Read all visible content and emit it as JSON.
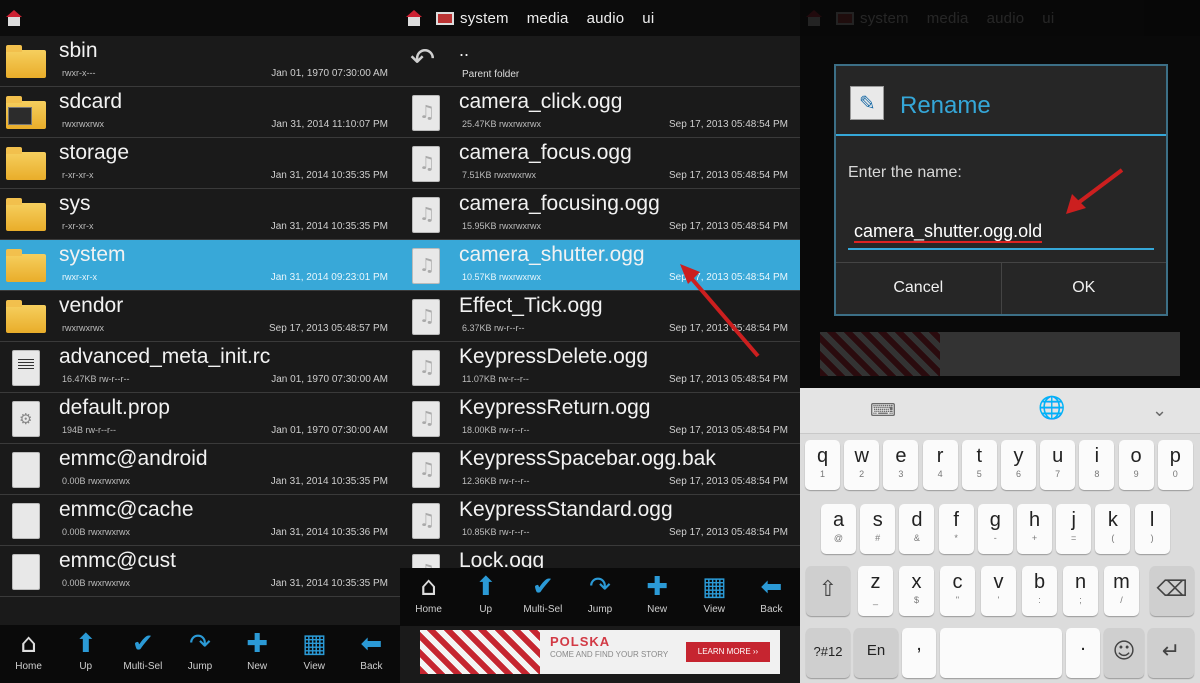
{
  "panel1": {
    "rows": [
      {
        "name": "sbin",
        "meta": "rwxr-x---",
        "date": "Jan 01, 1970 07:30:00 AM",
        "icon": "folder-icon"
      },
      {
        "name": "sdcard",
        "meta": "rwxrwxrwx",
        "date": "Jan 31, 2014 11:10:07 PM",
        "icon": "sdcard-folder-icon"
      },
      {
        "name": "storage",
        "meta": "r-xr-xr-x",
        "date": "Jan 31, 2014 10:35:35 PM",
        "icon": "folder-icon"
      },
      {
        "name": "sys",
        "meta": "r-xr-xr-x",
        "date": "Jan 31, 2014 10:35:35 PM",
        "icon": "folder-icon"
      },
      {
        "name": "system",
        "meta": "rwxr-xr-x",
        "date": "Jan 31, 2014 09:23:01 PM",
        "icon": "folder-icon",
        "selected": true
      },
      {
        "name": "vendor",
        "meta": "rwxrwxrwx",
        "date": "Sep 17, 2013 05:48:57 PM",
        "icon": "folder-icon"
      },
      {
        "name": "advanced_meta_init.rc",
        "meta": "16.47KB rw-r--r--",
        "date": "Jan 01, 1970 07:30:00 AM",
        "icon": "text-file-icon"
      },
      {
        "name": "default.prop",
        "meta": "194B rw-r--r--",
        "date": "Jan 01, 1970 07:30:00 AM",
        "icon": "settings-file-icon"
      },
      {
        "name": "emmc@android",
        "meta": "0.00B rwxrwxrwx",
        "date": "Jan 31, 2014 10:35:35 PM",
        "icon": "file-icon"
      },
      {
        "name": "emmc@cache",
        "meta": "0.00B rwxrwxrwx",
        "date": "Jan 31, 2014 10:35:36 PM",
        "icon": "file-icon"
      },
      {
        "name": "emmc@cust",
        "meta": "0.00B rwxrwxrwx",
        "date": "Jan 31, 2014 10:35:35 PM",
        "icon": "file-icon"
      }
    ]
  },
  "panel2": {
    "tabs": [
      "system",
      "media",
      "audio",
      "ui"
    ],
    "parent": {
      "name": "..",
      "label": "Parent folder"
    },
    "rows": [
      {
        "name": "camera_click.ogg",
        "meta": "25.47KB rwxrwxrwx",
        "date": "Sep 17, 2013 05:48:54 PM"
      },
      {
        "name": "camera_focus.ogg",
        "meta": "7.51KB rwxrwxrwx",
        "date": "Sep 17, 2013 05:48:54 PM"
      },
      {
        "name": "camera_focusing.ogg",
        "meta": "15.95KB rwxrwxrwx",
        "date": "Sep 17, 2013 05:48:54 PM"
      },
      {
        "name": "camera_shutter.ogg",
        "meta": "10.57KB rwxrwxrwx",
        "date": "Sep 17, 2013 05:48:54 PM",
        "selected": true
      },
      {
        "name": "Effect_Tick.ogg",
        "meta": "6.37KB rw-r--r--",
        "date": "Sep 17, 2013 05:48:54 PM"
      },
      {
        "name": "KeypressDelete.ogg",
        "meta": "11.07KB rw-r--r--",
        "date": "Sep 17, 2013 05:48:54 PM"
      },
      {
        "name": "KeypressReturn.ogg",
        "meta": "18.00KB rw-r--r--",
        "date": "Sep 17, 2013 05:48:54 PM"
      },
      {
        "name": "KeypressSpacebar.ogg.bak",
        "meta": "12.36KB rw-r--r--",
        "date": "Sep 17, 2013 05:48:54 PM"
      },
      {
        "name": "KeypressStandard.ogg",
        "meta": "10.85KB rw-r--r--",
        "date": "Sep 17, 2013 05:48:54 PM"
      },
      {
        "name": "Lock.ogg",
        "meta": "",
        "date": ""
      }
    ]
  },
  "toolbar": [
    {
      "label": "Home",
      "icon": "home-icon"
    },
    {
      "label": "Up",
      "icon": "up-arrow-icon"
    },
    {
      "label": "Multi-Sel",
      "icon": "checkmark-icon"
    },
    {
      "label": "Jump",
      "icon": "jump-arrow-icon"
    },
    {
      "label": "New",
      "icon": "plus-icon"
    },
    {
      "label": "View",
      "icon": "grid-icon"
    },
    {
      "label": "Back",
      "icon": "back-arrow-icon"
    }
  ],
  "ad": {
    "title": "POLSKA",
    "tagline": "COME AND FIND YOUR STORY",
    "cta": "LEARN MORE ››"
  },
  "dialog": {
    "title": "Rename",
    "prompt": "Enter the name:",
    "value": "camera_shutter.ogg.old",
    "cancel": "Cancel",
    "ok": "OK"
  },
  "keyboard": {
    "row1": [
      {
        "m": "q",
        "s": "1"
      },
      {
        "m": "w",
        "s": "2"
      },
      {
        "m": "e",
        "s": "3"
      },
      {
        "m": "r",
        "s": "4"
      },
      {
        "m": "t",
        "s": "5"
      },
      {
        "m": "y",
        "s": "6"
      },
      {
        "m": "u",
        "s": "7"
      },
      {
        "m": "i",
        "s": "8"
      },
      {
        "m": "o",
        "s": "9"
      },
      {
        "m": "p",
        "s": "0"
      }
    ],
    "row2": [
      {
        "m": "a",
        "s": "@"
      },
      {
        "m": "s",
        "s": "#"
      },
      {
        "m": "d",
        "s": "&"
      },
      {
        "m": "f",
        "s": "*"
      },
      {
        "m": "g",
        "s": "-"
      },
      {
        "m": "h",
        "s": "+"
      },
      {
        "m": "j",
        "s": "="
      },
      {
        "m": "k",
        "s": "("
      },
      {
        "m": "l",
        "s": ")"
      }
    ],
    "row3": [
      {
        "m": "z",
        "s": "_"
      },
      {
        "m": "x",
        "s": "$"
      },
      {
        "m": "c",
        "s": "\""
      },
      {
        "m": "v",
        "s": "'"
      },
      {
        "m": "b",
        "s": ":"
      },
      {
        "m": "n",
        "s": ";"
      },
      {
        "m": "m",
        "s": "/"
      }
    ],
    "sym_label": "?#12",
    "lang_label": "En",
    "comma": ",",
    "period": "."
  },
  "colors": {
    "accent": "#38a8d8",
    "arrow": "#cc1f1f",
    "folder": "#f0bd44"
  }
}
